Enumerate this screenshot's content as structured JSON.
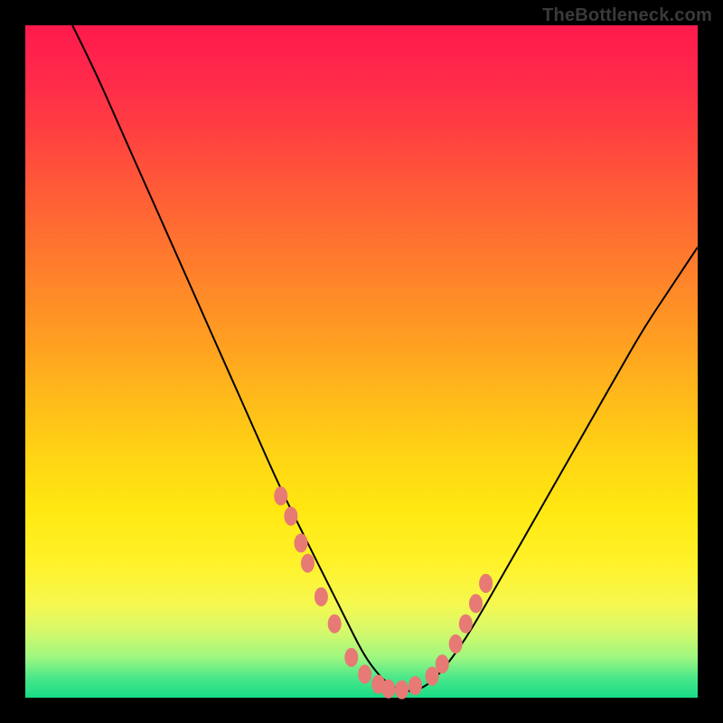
{
  "watermark": "TheBottleneck.com",
  "colors": {
    "page_bg": "#000000",
    "curve": "#000000",
    "dots": "#e77a74",
    "gradient_top": "#ff1a4d",
    "gradient_bottom": "#18db86"
  },
  "chart_data": {
    "type": "line",
    "title": "",
    "xlabel": "",
    "ylabel": "",
    "xlim": [
      0,
      100
    ],
    "ylim": [
      0,
      100
    ],
    "grid": false,
    "legend": false,
    "series": [
      {
        "name": "bottleneck-curve",
        "x": [
          7,
          10,
          14,
          18,
          22,
          26,
          30,
          34,
          38,
          42,
          45,
          48,
          50,
          52,
          54,
          56,
          58,
          60,
          62,
          65,
          68,
          72,
          76,
          80,
          84,
          88,
          92,
          96,
          100
        ],
        "y": [
          100,
          94,
          85,
          76,
          67,
          58,
          49,
          40,
          31,
          23,
          17,
          11,
          7,
          4,
          2,
          1,
          1,
          2,
          4,
          8,
          13,
          20,
          27,
          34,
          41,
          48,
          55,
          61,
          67
        ]
      }
    ],
    "points": {
      "name": "highlighted-dots",
      "x": [
        38,
        39.5,
        41,
        42,
        44,
        46,
        48.5,
        50.5,
        52.5,
        54,
        56,
        58,
        60.5,
        62,
        64,
        65.5,
        67,
        68.5
      ],
      "y": [
        30,
        27,
        23,
        20,
        15,
        11,
        6,
        3.5,
        2,
        1.3,
        1.2,
        1.8,
        3.2,
        5,
        8,
        11,
        14,
        17
      ]
    }
  }
}
